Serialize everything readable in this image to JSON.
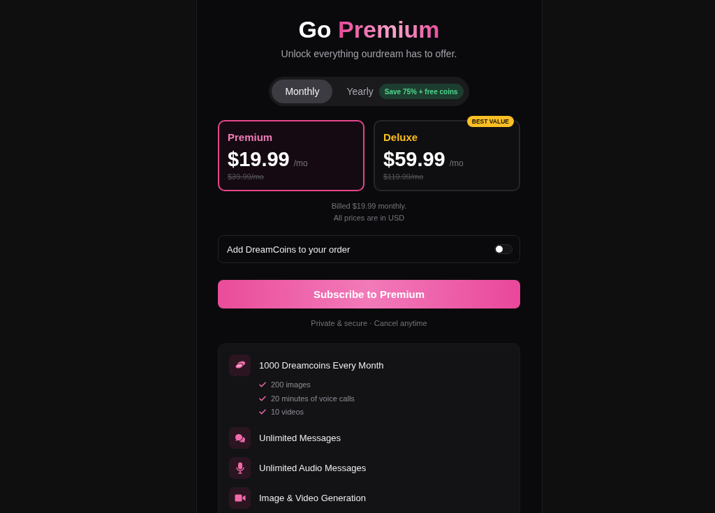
{
  "header": {
    "title": "Go",
    "title_accent": "Premium",
    "subtitle": "Unlock everything ourdream has to offer."
  },
  "billing_periods": [
    {
      "label": "Monthly",
      "selected": true
    },
    {
      "label": "Yearly",
      "selected": false,
      "badge": "Save 75% + free coins"
    }
  ],
  "plans": [
    {
      "name": "Premium",
      "color": "#f07cb8",
      "price": "$19.99",
      "period": "/mo",
      "original_price": "$39.99/mo",
      "selected": true
    },
    {
      "name": "Deluxe",
      "color": "#fbbf24",
      "price": "$59.99",
      "period": "/mo",
      "original_price": "$119.99/mo",
      "selected": false,
      "badge": "BEST VALUE"
    }
  ],
  "billing_note": [
    "Billed $19.99 monthly.",
    "All prices are in USD"
  ],
  "addon": {
    "label": "Add DreamCoins to your order",
    "on": false
  },
  "subscribe_button": "Subscribe to Premium",
  "footnote": "Private & secure · Cancel anytime",
  "features": [
    {
      "title": "1000 Dreamcoins Every Month",
      "details": [
        "200 images",
        "20 minutes of voice calls",
        "10 videos"
      ]
    },
    {
      "title": "Unlimited Messages"
    },
    {
      "title": "Unlimited Audio Messages"
    },
    {
      "title": "Image & Video Generation"
    }
  ]
}
